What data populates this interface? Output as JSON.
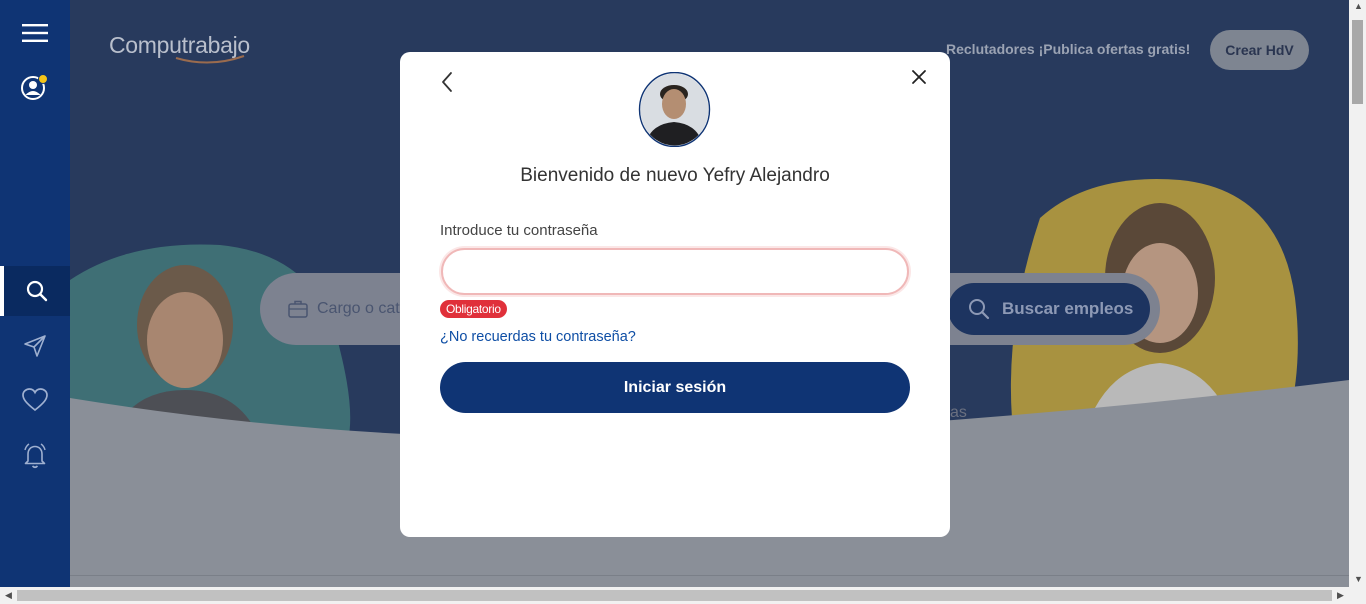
{
  "brand": {
    "logo_text": "Computrabajo"
  },
  "header": {
    "recruiters_text": "Reclutadores ¡Publica ofertas gratis!",
    "create_cv_label": "Crear HdV"
  },
  "search": {
    "placeholder": "Cargo o cate",
    "button_label": "Buscar empleos",
    "partial_text": "as"
  },
  "sidebar": {
    "items": [
      {
        "name": "menu",
        "icon": "hamburger-menu-icon"
      },
      {
        "name": "profile",
        "icon": "user-profile-icon"
      },
      {
        "name": "search",
        "icon": "search-icon",
        "active": true
      },
      {
        "name": "applications",
        "icon": "send-icon"
      },
      {
        "name": "favorites",
        "icon": "heart-icon"
      },
      {
        "name": "alerts",
        "icon": "bell-icon"
      }
    ]
  },
  "modal": {
    "welcome_text": "Bienvenido de nuevo Yefry Alejandro",
    "password_label": "Introduce tu contraseña",
    "password_value": "",
    "required_badge": "Obligatorio",
    "forgot_link": "¿No recuerdas tu contraseña?",
    "login_button": "Iniciar sesión"
  },
  "colors": {
    "primary": "#0f3474",
    "error": "#e0303a",
    "link": "#0e4ea5",
    "notification_dot": "#f5c518"
  }
}
